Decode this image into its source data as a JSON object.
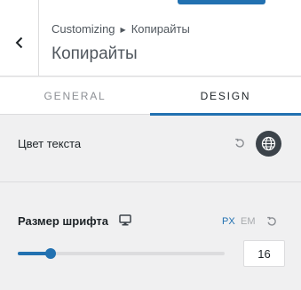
{
  "header": {
    "breadcrumb_root": "Customizing",
    "breadcrumb_current": "Копирайты",
    "title": "Копирайты"
  },
  "tabs": [
    {
      "label": "GENERAL",
      "active": false
    },
    {
      "label": "DESIGN",
      "active": true
    }
  ],
  "text_color": {
    "label": "Цвет текста",
    "reset_icon": "undo-icon",
    "picker_icon": "globe-icon"
  },
  "font_size": {
    "label": "Размер шрифта",
    "device_icon": "desktop-icon",
    "units": [
      "PX",
      "EM"
    ],
    "active_unit": "PX",
    "value": "16",
    "slider_fraction": 0.16
  },
  "colors": {
    "accent": "#2271b1",
    "picker_bg": "#3c434a",
    "panel_bg": "#f0f0f1"
  }
}
